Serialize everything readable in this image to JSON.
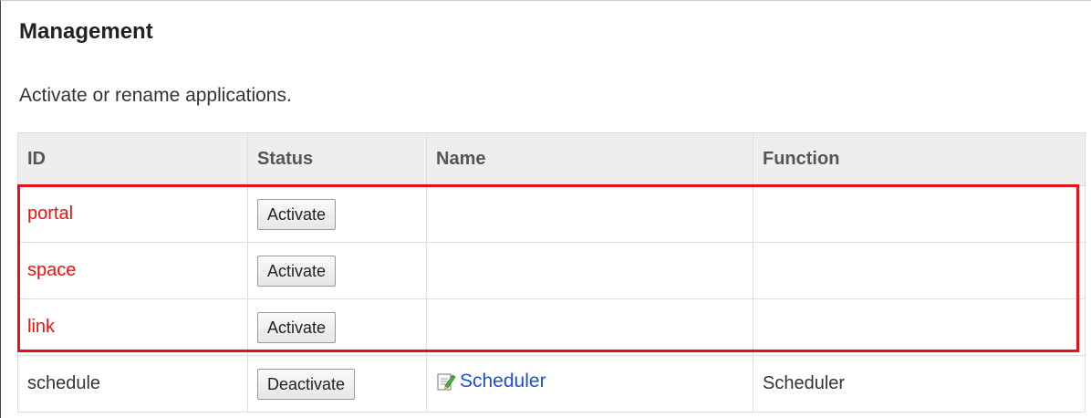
{
  "page": {
    "title": "Management",
    "description": "Activate or rename applications."
  },
  "table": {
    "columns": [
      "ID",
      "Status",
      "Name",
      "Function"
    ],
    "rows": [
      {
        "id": "portal",
        "status_button": "Activate",
        "name": "",
        "function": ""
      },
      {
        "id": "space",
        "status_button": "Activate",
        "name": "",
        "function": ""
      },
      {
        "id": "link",
        "status_button": "Activate",
        "name": "",
        "function": ""
      },
      {
        "id": "schedule",
        "status_button": "Deactivate",
        "name": "Scheduler",
        "function": "Scheduler",
        "name_icon": "edit-icon"
      }
    ]
  },
  "colors": {
    "highlight_border": "#e8101a",
    "highlighted_id_text": "#ee1111",
    "link": "#1d4fcf",
    "header_bg": "#eeeeee"
  }
}
